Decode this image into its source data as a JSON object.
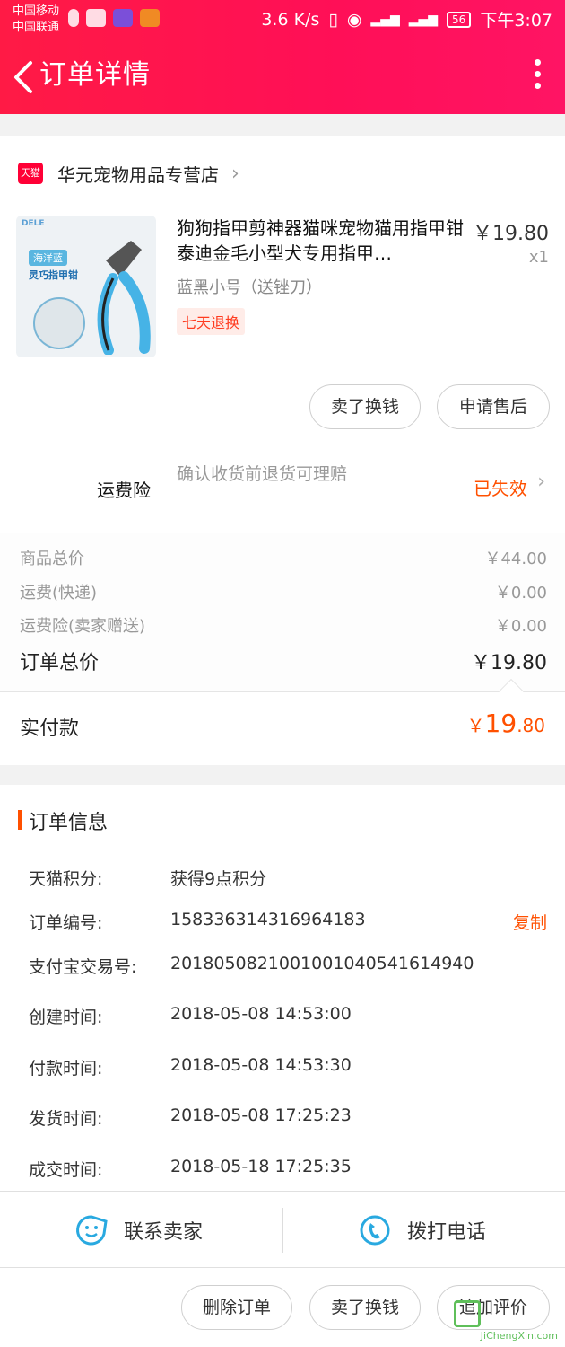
{
  "status_bar": {
    "carrier_1": "中国移动",
    "carrier_2": "中国联通",
    "speed": "3.6 K/s",
    "battery": "56",
    "time": "下午3:07"
  },
  "header": {
    "title": "订单详情"
  },
  "shop": {
    "badge": "天猫",
    "name": "华元宠物用品专营店"
  },
  "product": {
    "image_brand": "DELE",
    "image_caption_1": "海洋蓝",
    "image_caption_2": "灵巧指甲钳",
    "title": "狗狗指甲剪神器猫咪宠物猫用指甲钳泰迪金毛小型犬专用指甲…",
    "price": "￥19.80",
    "qty": "x1",
    "spec": "蓝黑小号（送锉刀）",
    "badge": "七天退换"
  },
  "item_actions": {
    "sell": "卖了换钱",
    "after_sale": "申请售后"
  },
  "insurance": {
    "label": "运费险",
    "desc": "确认收货前退货可理赔",
    "status": "已失效"
  },
  "summary": {
    "goods_label": "商品总价",
    "goods_value": "￥44.00",
    "shipping_label": "运费(快递)",
    "shipping_value": "￥0.00",
    "ins_label": "运费险(卖家赠送)",
    "ins_value": "￥0.00",
    "total_label": "订单总价",
    "total_value": "￥19.80",
    "paid_label": "实付款",
    "paid_currency": "￥",
    "paid_int": "19",
    "paid_dec": ".80"
  },
  "order_info": {
    "title": "订单信息",
    "copy": "复制",
    "rows": [
      {
        "k": "天猫积分:",
        "v": "获得9点积分"
      },
      {
        "k": "订单编号:",
        "v": "158336314316964183"
      },
      {
        "k": "支付宝交易号:",
        "v": "2018050821001001040541614940"
      },
      {
        "k": "创建时间:",
        "v": "2018-05-08 14:53:00"
      },
      {
        "k": "付款时间:",
        "v": "2018-05-08 14:53:30"
      },
      {
        "k": "发货时间:",
        "v": "2018-05-08 17:25:23"
      },
      {
        "k": "成交时间:",
        "v": "2018-05-18 17:25:35"
      }
    ]
  },
  "contact": {
    "seller": "联系卖家",
    "call": "拨打电话"
  },
  "bottom_actions": {
    "delete": "删除订单",
    "sell": "卖了换钱",
    "review": "追加评价"
  },
  "watermark": {
    "text": "JiChengXin.com"
  },
  "colors": {
    "brand": "#ff0f57",
    "accent": "#ff5000",
    "icon_blue": "#29a9e0"
  }
}
